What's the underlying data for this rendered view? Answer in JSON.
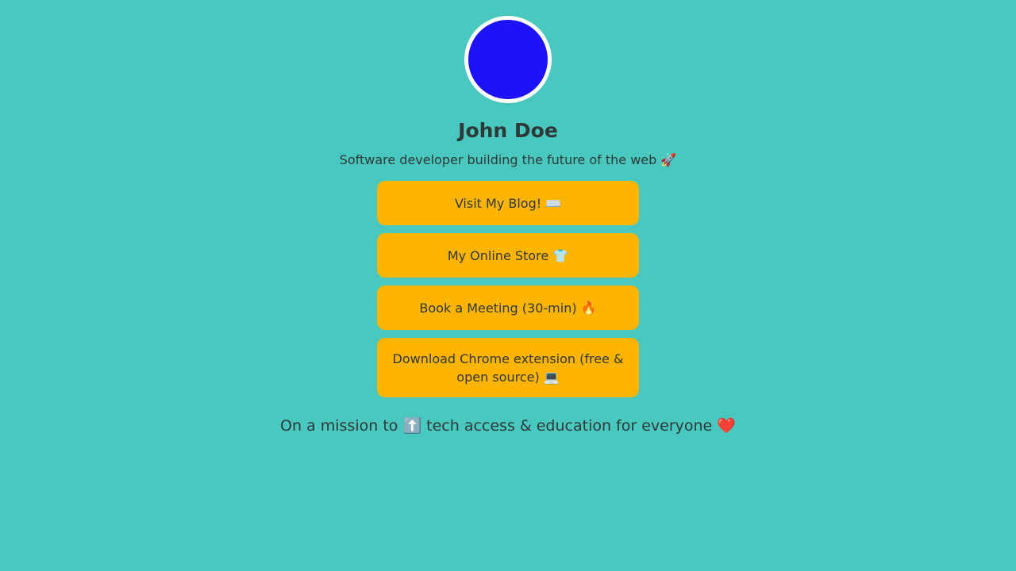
{
  "profile": {
    "avatar_color": "#1d12f8",
    "name": "John Doe",
    "bio": "Software developer building the future of the web 🚀"
  },
  "links": [
    {
      "label": "Visit My Blog! ⌨️"
    },
    {
      "label": "My Online Store 👕"
    },
    {
      "label": "Book a Meeting (30-min) 🔥"
    },
    {
      "label": "Download Chrome extension (free & open source) 💻"
    }
  ],
  "footer": {
    "mission": "On a mission to ⬆️ tech access & education for everyone ❤️"
  },
  "colors": {
    "background": "#48c8be",
    "button": "#ffb400",
    "text": "#2f3838"
  }
}
